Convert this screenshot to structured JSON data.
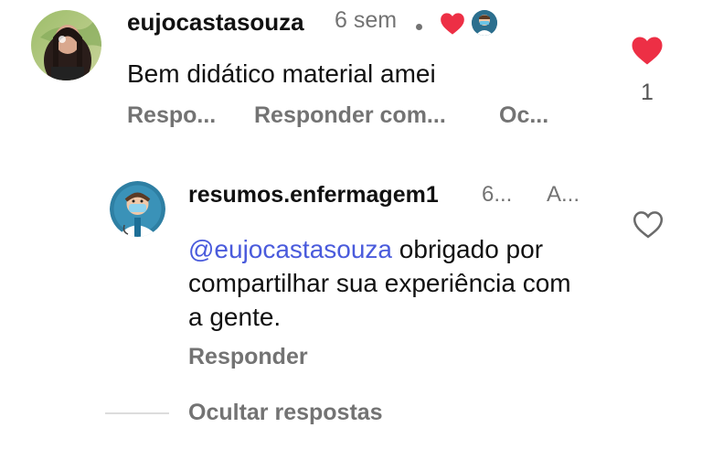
{
  "comment": {
    "username": "eujocastasouza",
    "time": "6 sem",
    "text": "Bem didático material amei",
    "like_count": "1",
    "actions": {
      "reply": "Respo...",
      "reply_with": "Responder com...",
      "hide": "Oc..."
    },
    "liked": true
  },
  "reply": {
    "username": "resumos.enfermagem1",
    "time": "6...",
    "author_badge": "A...",
    "mention": "@eujocastasouza",
    "text": " obrigado por compartilhar sua experiência com a gente.",
    "reply_label": "Responder",
    "liked": false
  },
  "thread": {
    "hide_replies_label": "Ocultar respostas"
  },
  "colors": {
    "like_red": "#ed2f45",
    "mention_blue": "#4a5bdc",
    "muted": "#737373"
  }
}
